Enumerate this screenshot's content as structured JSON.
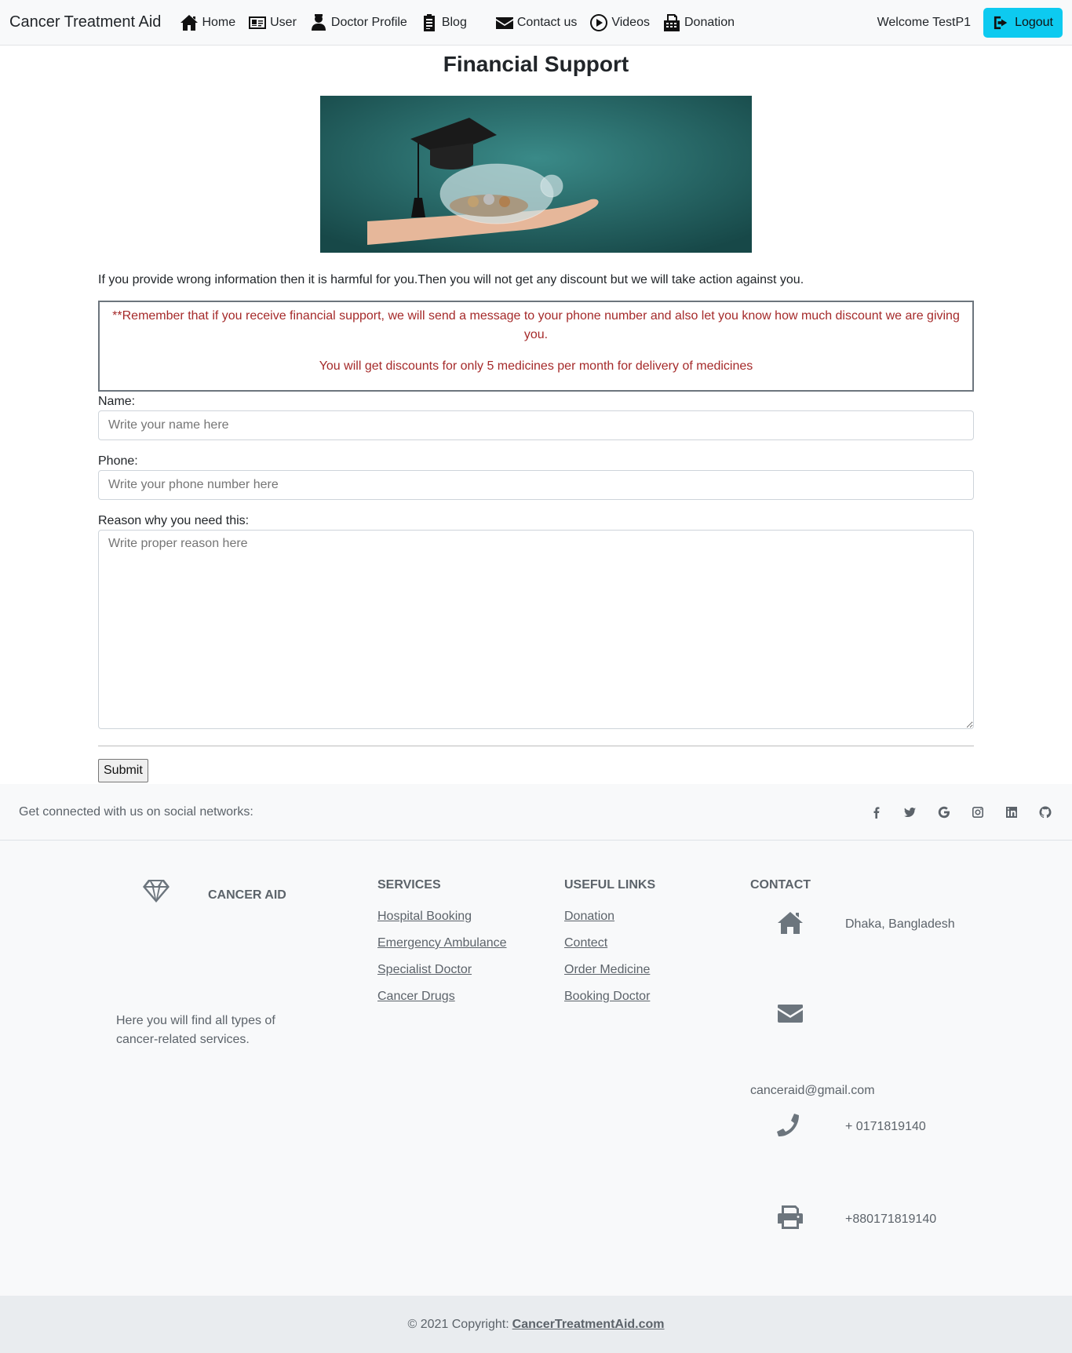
{
  "navbar": {
    "brand": "Cancer Treatment Aid",
    "links": [
      {
        "label": "Home",
        "icon": "home-icon"
      },
      {
        "label": "User",
        "icon": "id-card-icon"
      },
      {
        "label": "Doctor Profile",
        "icon": "doctor-icon"
      },
      {
        "label": "Blog",
        "icon": "clipboard-icon"
      },
      {
        "label": "Contact us",
        "icon": "envelope-icon"
      },
      {
        "label": "Videos",
        "icon": "play-circle-icon"
      },
      {
        "label": "Donation",
        "icon": "fax-icon"
      }
    ],
    "welcome": "Welcome TestP1",
    "logout_label": "Logout",
    "logout_color": "#0dcaf0"
  },
  "main": {
    "title": "Financial Support",
    "hero_image": "graduation-cap-piggy-bank-image",
    "warning": "If you provide wrong information then it is harmful for you.Then you will not get any discount but we will take action against you.",
    "notice": {
      "line1": "**Remember that if you receive financial support, we will send a message to your phone number and also let you know how much discount we are giving you.",
      "line2": "You will get discounts for only 5 medicines per month for delivery of medicines",
      "color": "#a52a2a"
    },
    "form": {
      "name_label": "Name:",
      "name_placeholder": "Write your name here",
      "phone_label": "Phone:",
      "phone_placeholder": "Write your phone number here",
      "reason_label": "Reason why you need this:",
      "reason_placeholder": "Write proper reason here",
      "submit_label": "Submit"
    }
  },
  "footer": {
    "social_text": "Get connected with us on social networks:",
    "social_icons": [
      {
        "name": "facebook-icon",
        "glyph": "f"
      },
      {
        "name": "twitter-icon",
        "glyph": "t"
      },
      {
        "name": "google-icon",
        "glyph": "G"
      },
      {
        "name": "instagram-icon",
        "glyph": "i"
      },
      {
        "name": "linkedin-icon",
        "glyph": "in"
      },
      {
        "name": "github-icon",
        "glyph": "gh"
      }
    ],
    "brand_name": "CANCER AID",
    "brand_desc": "Here you will find all types of cancer-related services.",
    "services_head": "SERVICES",
    "services": [
      "Hospital Booking",
      "Emergency Ambulance",
      "Specialist Doctor",
      "Cancer Drugs"
    ],
    "links_head": "USEFUL LINKS",
    "links": [
      "Donation",
      "Contect",
      "Order Medicine",
      "Booking Doctor"
    ],
    "contact_head": "CONTACT",
    "address": "Dhaka, Bangladesh",
    "email": "canceraid@gmail.com",
    "phone": "+ 0171819140",
    "fax": "+880171819140",
    "copyright_prefix": "© 2021 Copyright:",
    "copyright_link": "CancerTreatmentAid.com"
  }
}
